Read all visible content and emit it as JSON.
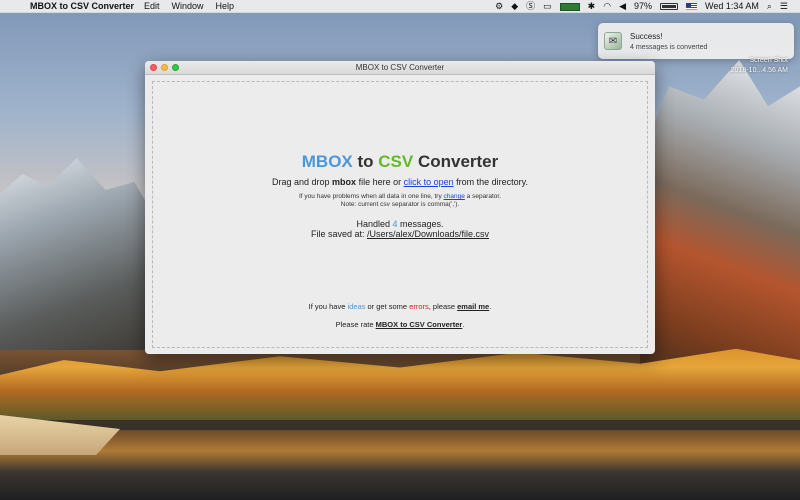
{
  "menubar": {
    "apple_glyph": "",
    "app_name": "MBOX to CSV Converter",
    "items": [
      "Edit",
      "Window",
      "Help"
    ],
    "battery": "97%",
    "clock": "Wed 1:34 AM"
  },
  "notification": {
    "title": "Success!",
    "body": "4 messages is converted"
  },
  "desktop": {
    "screenshot_label_line1": "Screen Shot",
    "screenshot_label_line2": "2018-10...4.56 AM"
  },
  "window": {
    "title": "MBOX to CSV Converter",
    "headline": {
      "part1": "MBOX",
      "part2": " to ",
      "part3": "CSV",
      "part4": " Converter"
    },
    "instruction": {
      "prefix": "Drag and drop ",
      "bold": "mbox",
      "middle": " file here or ",
      "link": "click to open",
      "suffix": " from the directory."
    },
    "separator_note": {
      "line1_prefix": "If you have problems when all data in one line, try ",
      "line1_link": "change",
      "line1_suffix": " a separator.",
      "line2": "Note: current csv separator is comma(',')."
    },
    "status": {
      "handled_prefix": "Handled ",
      "count": "4",
      "handled_suffix": " messages.",
      "saved_prefix": "File saved at: ",
      "path": "/Users/alex/Downloads/file.csv"
    },
    "feedback": {
      "p1": "If you have ",
      "ideas": "ideas",
      "p2": " or get some ",
      "errors": "errors",
      "p3": ", please ",
      "email": "email me",
      "p4": "."
    },
    "rate": {
      "prefix": "Please rate ",
      "link": "MBOX to CSV Converter",
      "suffix": "."
    }
  },
  "colors": {
    "mbox_blue": "#4a97d9",
    "csv_green": "#65b82a",
    "error_red": "#d42020",
    "link_blue": "#1b3fe0"
  }
}
